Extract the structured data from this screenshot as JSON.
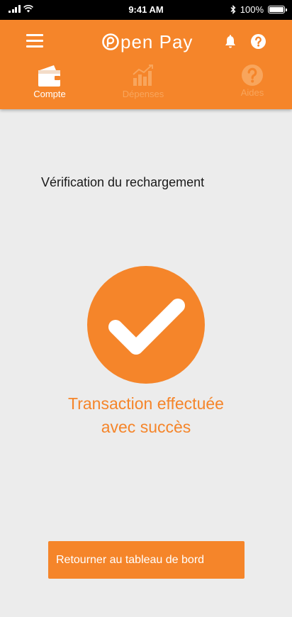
{
  "status_bar": {
    "time": "9:41 AM",
    "battery_percent": "100%"
  },
  "header": {
    "brand_letter": "O",
    "brand_text": "pen Pay",
    "brand_color": "#f5852a",
    "icons": [
      "menu-icon",
      "bell-icon",
      "help-icon"
    ]
  },
  "tabs": [
    {
      "label": "Compte",
      "icon": "wallet-icon",
      "active": true
    },
    {
      "label": "Dépenses",
      "icon": "chart-icon",
      "active": false
    },
    {
      "label": "Aides",
      "icon": "help-icon",
      "active": false
    }
  ],
  "main": {
    "title": "Vérification du rechargement",
    "success_icon": "checkmark-icon",
    "success_line1": "Transaction effectuée",
    "success_line2": "avec succès",
    "button_label": "Retourner au tableau de bord"
  }
}
